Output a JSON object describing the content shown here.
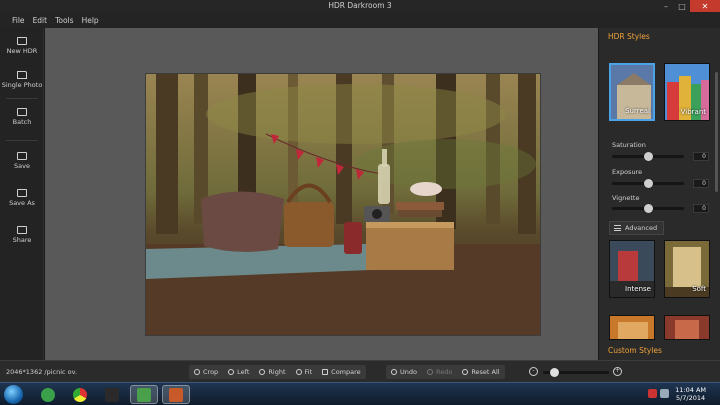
{
  "window": {
    "title": "HDR Darkroom 3",
    "controls": [
      "–",
      "□",
      "✕"
    ]
  },
  "menu": [
    "File",
    "Edit",
    "Tools",
    "Help"
  ],
  "tools": [
    {
      "label": "New HDR",
      "icon": "new-hdr-icon"
    },
    {
      "label": "Single Photo",
      "icon": "single-photo-icon"
    },
    {
      "label": "Batch",
      "icon": "batch-icon"
    },
    {
      "label": "Save",
      "icon": "save-icon"
    },
    {
      "label": "Save As",
      "icon": "save-as-icon"
    },
    {
      "label": "Share",
      "icon": "share-icon"
    }
  ],
  "right_panel": {
    "hdr_styles_title": "HDR Styles",
    "styles": [
      {
        "label": "Surreal",
        "selected": true
      },
      {
        "label": "Vibrant",
        "selected": false
      },
      {
        "label": "Intense",
        "selected": false
      },
      {
        "label": "Soft",
        "selected": false
      }
    ],
    "sliders": [
      {
        "label": "Saturation",
        "value": "0",
        "level": 0.5
      },
      {
        "label": "Exposure",
        "value": "0",
        "level": 0.5
      },
      {
        "label": "Vignette",
        "value": "0",
        "level": 0.5
      }
    ],
    "advanced_label": "Advanced",
    "custom_styles_title": "Custom Styles"
  },
  "status": {
    "image_info": "2046*1362 /picnic ov.",
    "zoom_level": 0.2
  },
  "bottom_toolbar": {
    "group1": [
      {
        "label": "Crop",
        "icon": "crop-icon"
      },
      {
        "label": "Left",
        "icon": "rotate-left-icon"
      },
      {
        "label": "Right",
        "icon": "rotate-right-icon"
      },
      {
        "label": "Fit",
        "icon": "fit-icon"
      },
      {
        "label": "Compare",
        "icon": "compare-icon"
      }
    ],
    "group2": [
      {
        "label": "Undo",
        "icon": "undo-icon",
        "enabled": true
      },
      {
        "label": "Redo",
        "icon": "redo-icon",
        "enabled": false
      },
      {
        "label": "Reset All",
        "icon": "reset-icon",
        "enabled": true
      }
    ]
  },
  "taskbar": {
    "time": "11:04 AM",
    "date": "5/7/2014"
  },
  "colors": {
    "accent": "#f0a23a",
    "selection": "#4aa3e6",
    "close": "#c43b2e"
  }
}
